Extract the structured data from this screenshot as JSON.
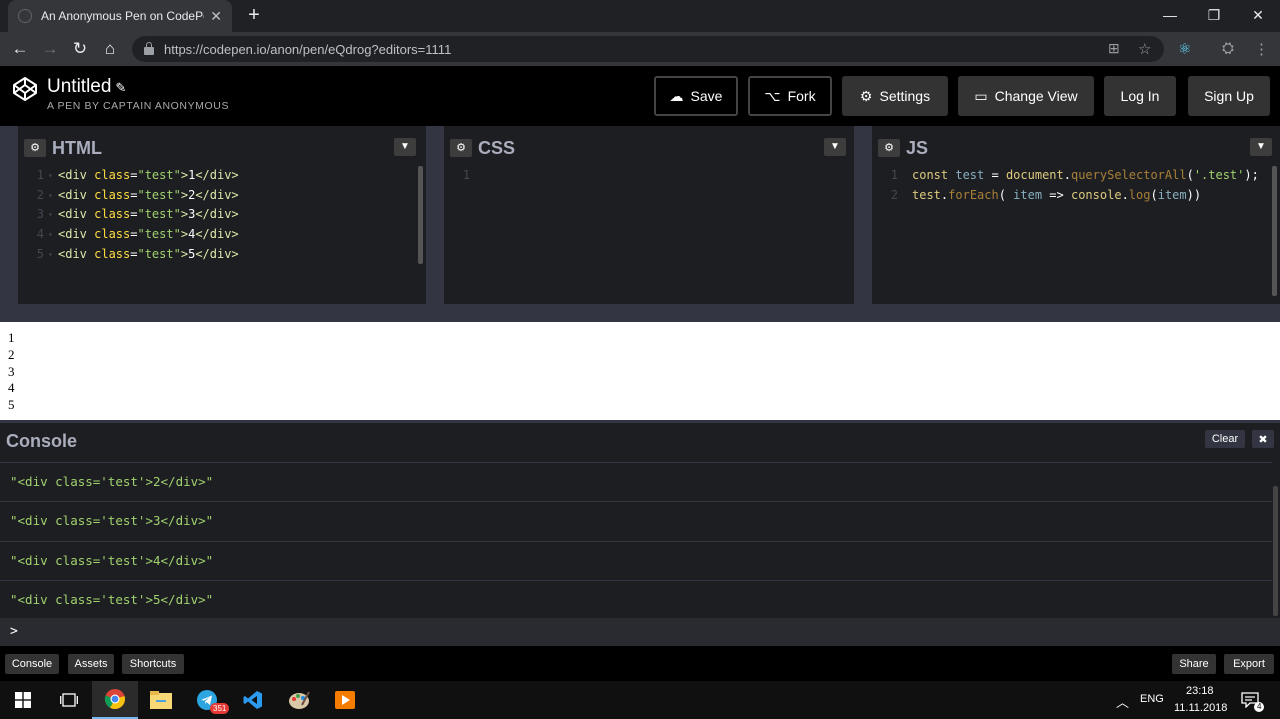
{
  "browser": {
    "tab_title": "An Anonymous Pen on CodePen",
    "tab_close": "✕",
    "new_tab": "+",
    "url": "https://codepen.io/anon/pen/eQdrog?editors=1111",
    "window": {
      "minimize": "—",
      "maximize": "❐",
      "close": "✕"
    }
  },
  "header": {
    "title": "Untitled",
    "subtitle": "A PEN BY CAPTAIN ANONYMOUS",
    "buttons": {
      "save": "Save",
      "fork": "Fork",
      "settings": "Settings",
      "change_view": "Change View",
      "login": "Log In",
      "signup": "Sign Up"
    }
  },
  "editors": {
    "html": {
      "name": "HTML",
      "lines": [
        {
          "n": "1",
          "open": "<div ",
          "attr": "class",
          "eq": "=",
          "val": "\"test\"",
          "close": ">",
          "text": "1",
          "end": "</div>"
        },
        {
          "n": "2",
          "open": "<div ",
          "attr": "class",
          "eq": "=",
          "val": "\"test\"",
          "close": ">",
          "text": "2",
          "end": "</div>"
        },
        {
          "n": "3",
          "open": "<div ",
          "attr": "class",
          "eq": "=",
          "val": "\"test\"",
          "close": ">",
          "text": "3",
          "end": "</div>"
        },
        {
          "n": "4",
          "open": "<div ",
          "attr": "class",
          "eq": "=",
          "val": "\"test\"",
          "close": ">",
          "text": "4",
          "end": "</div>"
        },
        {
          "n": "5",
          "open": "<div ",
          "attr": "class",
          "eq": "=",
          "val": "\"test\"",
          "close": ">",
          "text": "5",
          "end": "</div>"
        }
      ]
    },
    "css": {
      "name": "CSS",
      "lines": [
        {
          "n": "1"
        }
      ]
    },
    "js": {
      "name": "JS",
      "line1": {
        "n": "1",
        "a": "const ",
        "b": "test",
        "c": " = ",
        "d": "document",
        "e": ".",
        "f": "querySelectorAll",
        "g": "(",
        "h": "'.test'",
        "i": ");"
      },
      "line2": {
        "n": "2",
        "a": "test",
        "b": ".",
        "c": "forEach",
        "d": "( ",
        "e": "item",
        "f": " => ",
        "g": "console",
        "h": ".",
        "i": "log",
        "j": "(",
        "k": "item",
        "l": "))"
      }
    }
  },
  "preview": {
    "lines": [
      "1",
      "2",
      "3",
      "4",
      "5"
    ]
  },
  "console": {
    "title": "Console",
    "clear": "Clear",
    "close": "✖",
    "rows": [
      "\"<div class='test'>2</div>\"",
      "\"<div class='test'>3</div>\"",
      "\"<div class='test'>4</div>\"",
      "\"<div class='test'>5</div>\""
    ],
    "prompt": ">"
  },
  "footer": {
    "console": "Console",
    "assets": "Assets",
    "shortcuts": "Shortcuts",
    "share": "Share",
    "export": "Export"
  },
  "taskbar": {
    "lang": "ENG",
    "time": "23:18",
    "date": "11.11.2018",
    "telegram_badge": "351",
    "notif_count": "4"
  },
  "colors": {
    "accent": "#76b9ed",
    "codepen_bg": "#1d1e22",
    "divider": "#333642"
  }
}
